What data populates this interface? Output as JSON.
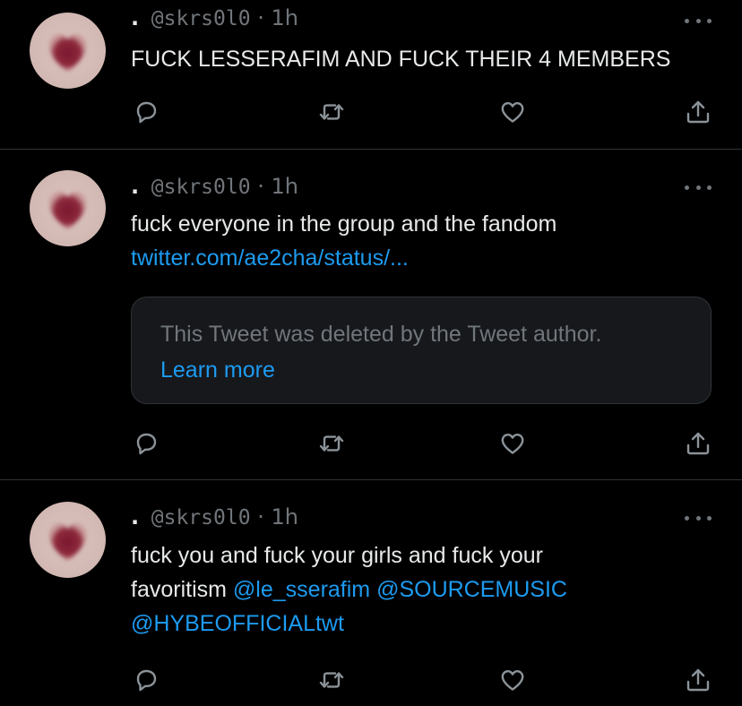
{
  "tweets": [
    {
      "handle": "@skrs0l0",
      "time": "· 1h",
      "lead_dot": ".",
      "text": "FUCK LESSERAFIM AND FUCK THEIR 4 MEMBERS"
    },
    {
      "handle": "@skrs0l0",
      "time": "· 1h",
      "lead_dot": ".",
      "text": "fuck everyone in the group and the fandom",
      "link": "twitter.com/ae2cha/status/...",
      "quote_deleted": "This Tweet was deleted by the Tweet author.",
      "quote_learn_more": "Learn more"
    },
    {
      "handle": "@skrs0l0",
      "time": "· 1h",
      "lead_dot": ".",
      "text_line1": "fuck you and fuck your girls and fuck your",
      "text_line2_prefix": "favoritism",
      "mention1": "@le_sserafim",
      "mention2": "@SOURCEMUSIC",
      "mention3": "@HYBEOFFICIALtwt"
    }
  ],
  "icons": {
    "reply": "reply-icon",
    "retweet": "retweet-icon",
    "like": "heart-icon",
    "share": "share-icon",
    "more": "more-icon",
    "avatar": "heart-avatar"
  },
  "colors": {
    "background": "#000000",
    "text": "#e7e9ea",
    "muted": "#71767b",
    "link": "#1d9bf0",
    "avatar_heart": "#8a1f33"
  }
}
